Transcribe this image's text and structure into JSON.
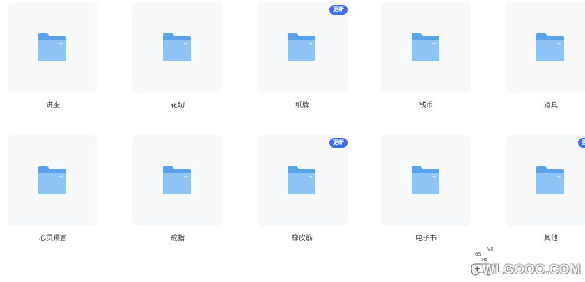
{
  "folders": [
    {
      "label": "讲座",
      "badge": ""
    },
    {
      "label": "花切",
      "badge": ""
    },
    {
      "label": "纸牌",
      "badge": "更新"
    },
    {
      "label": "钱币",
      "badge": ""
    },
    {
      "label": "道具",
      "badge": ""
    },
    {
      "label": "心灵预言",
      "badge": ""
    },
    {
      "label": "戒指",
      "badge": ""
    },
    {
      "label": "橡皮筋",
      "badge": "更新"
    },
    {
      "label": "电子书",
      "badge": ""
    },
    {
      "label": "其他",
      "badge": "更新"
    }
  ],
  "watermark": {
    "text": "WLGOOO.COM",
    "small_top": "VX",
    "small_left": "GS",
    "small_mid": "H5"
  },
  "colors": {
    "tile_bg": "#f7f8fa",
    "badge_bg": "#3d6df5",
    "folder_back": "#5aa3ec",
    "folder_front": "#8ec5f6"
  },
  "icons": {
    "folder": "folder-icon",
    "watermark": "gamepad-icon"
  }
}
